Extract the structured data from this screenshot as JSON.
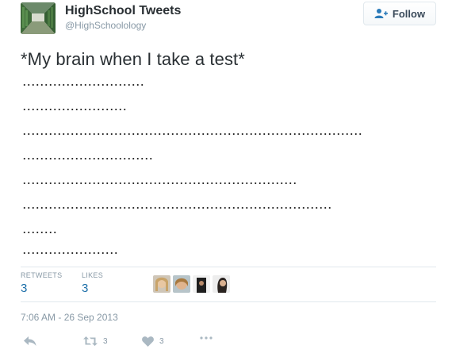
{
  "author": {
    "name": "HighSchool Tweets",
    "handle": "@HighSchoolology",
    "avatar_icon": "school-hallway-avatar"
  },
  "follow_button": {
    "label": "Follow",
    "icon": "follow-person-icon"
  },
  "tweet": {
    "text": "*My brain when I take a test*",
    "dot_rows": [
      28,
      24,
      78,
      30,
      63,
      71,
      8,
      22
    ]
  },
  "stats": {
    "retweets_label": "RETWEETS",
    "retweets_value": "3",
    "likes_label": "LIKES",
    "likes_value": "3",
    "liker_avatar_count": 4
  },
  "timestamp": "7:06 AM - 26 Sep 2013",
  "actions": {
    "reply_icon": "reply-icon",
    "retweet_icon": "retweet-icon",
    "retweet_count": "3",
    "like_icon": "heart-icon",
    "like_count": "3",
    "more_icon": "more-icon"
  },
  "colors": {
    "text": "#292f33",
    "muted": "#8899a6",
    "stat_value": "#1b6ea8",
    "divider": "#e1e8ed",
    "follow_icon": "#2b7bb9",
    "action_icon": "#aab8c2"
  }
}
